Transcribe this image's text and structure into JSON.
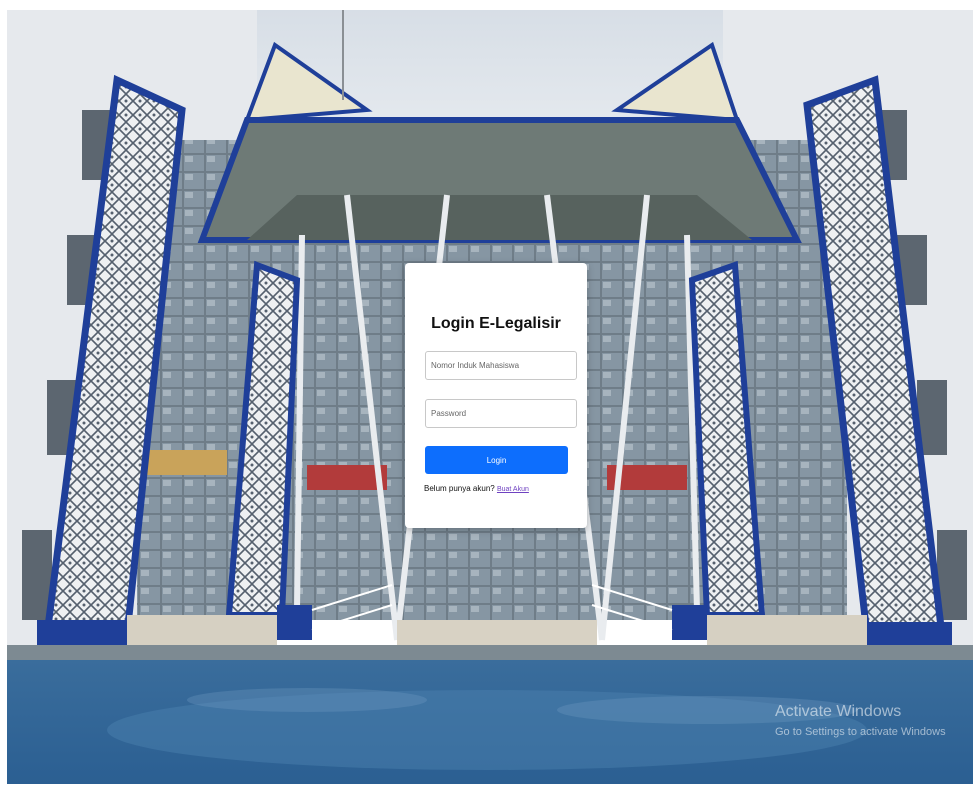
{
  "login": {
    "title": "Login E-Legalisir",
    "nim_placeholder": "Nomor Induk Mahasiswa",
    "password_placeholder": "Password",
    "button_label": "Login",
    "register_prompt": "Belum punya akun?",
    "register_link": "Buat Akun"
  },
  "watermark": {
    "title": "Activate Windows",
    "subtitle": "Go to Settings to activate Windows"
  },
  "colors": {
    "primary": "#0d6efd",
    "link": "#6f42c1",
    "building_blue": "#1f3f99"
  }
}
